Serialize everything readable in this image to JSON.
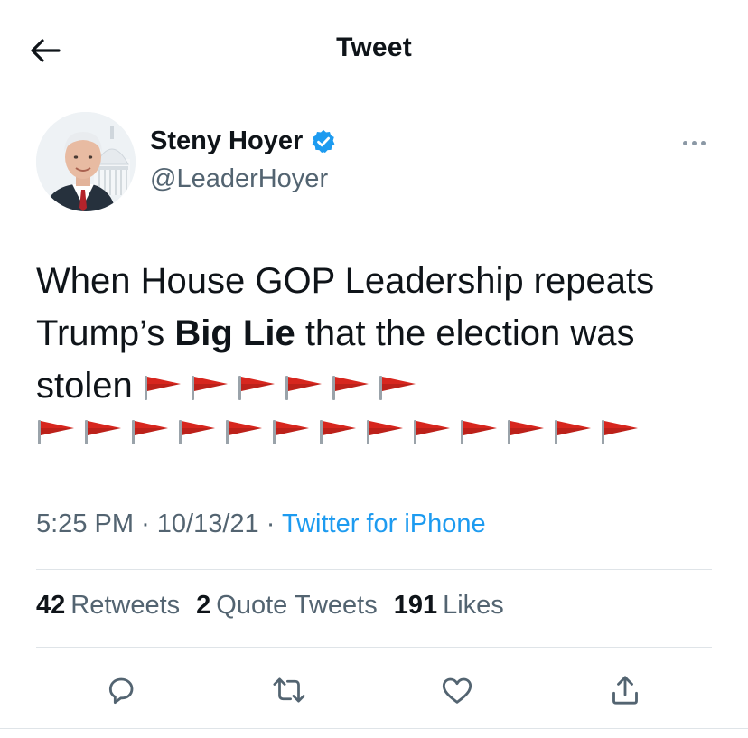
{
  "header": {
    "title": "Tweet",
    "back_icon": "back-arrow-icon"
  },
  "author": {
    "display_name": "Steny Hoyer",
    "handle": "@LeaderHoyer",
    "verified_icon": "verified-badge-icon",
    "verified_color": "#1d9bf0"
  },
  "tweet": {
    "text_before_bold": "When House GOP Leadership repeats Trump’s ",
    "bold_text": "Big Lie",
    "text_after_bold": " that the election was stolen ",
    "flag_icon": "red-flag-emoji",
    "flags_line1_count": 6,
    "flags_line2_count": 13,
    "flag_color": "#d7261e"
  },
  "meta": {
    "time": "5:25 PM",
    "separator": "·",
    "date": "10/13/21",
    "source": "Twitter for iPhone"
  },
  "stats": {
    "retweets_count": "42",
    "retweets_label": "Retweets",
    "quotes_count": "2",
    "quotes_label": "Quote Tweets",
    "likes_count": "191",
    "likes_label": "Likes"
  },
  "actions": [
    "reply-icon",
    "retweet-icon",
    "like-icon",
    "share-icon"
  ],
  "colors": {
    "text": "#0f1419",
    "secondary": "#536471",
    "accent": "#1d9bf0",
    "icon": "#536471"
  }
}
